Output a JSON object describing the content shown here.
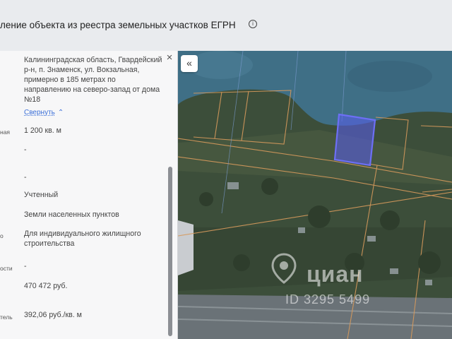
{
  "header": {
    "title": "ление объекта из реестра земельных участков ЕГРН",
    "info_icon": "info-icon"
  },
  "panel": {
    "address": "Калининградская область, Гвардейский р-н, п. Знаменск, ул. Вокзальная, примерно в 185 метрах по направлению на северо-запад от дома №18",
    "collapse_label": "Свернуть",
    "rows": [
      {
        "label": "ная",
        "value": "1 200 кв. м"
      },
      {
        "label": "",
        "value": "-"
      },
      {
        "label": "",
        "value": "-"
      },
      {
        "label": "",
        "value": "Учтенный"
      },
      {
        "label": "",
        "value": "Земли населенных пунктов"
      },
      {
        "label": "о",
        "value": "Для индивидуального жилищного строительства"
      },
      {
        "label": "ости",
        "value": "-"
      },
      {
        "label": "",
        "value": "470 472 руб."
      },
      {
        "label": "тель",
        "value": "392,06 руб./кв. м"
      }
    ]
  },
  "map": {
    "expand_icon": "double-chevron-left-icon",
    "watermark_logo": "циан",
    "watermark_id": "ID 3295 5499",
    "colors": {
      "water": "#3f6f86",
      "land": "#3c4e3a",
      "selected_parcel": "#5a5cf0",
      "parcel_border": "#d79a5c",
      "road": "#5d6468"
    }
  }
}
